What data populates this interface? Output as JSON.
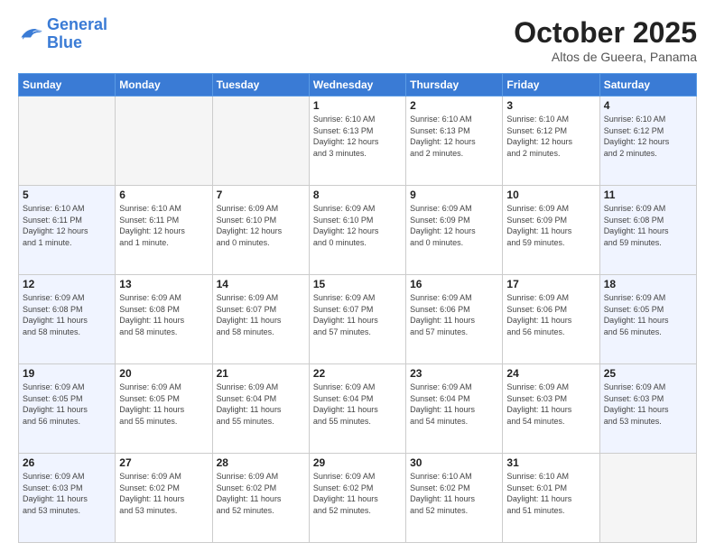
{
  "header": {
    "logo_line1": "General",
    "logo_line2": "Blue",
    "month": "October 2025",
    "location": "Altos de Gueera, Panama"
  },
  "weekdays": [
    "Sunday",
    "Monday",
    "Tuesday",
    "Wednesday",
    "Thursday",
    "Friday",
    "Saturday"
  ],
  "weeks": [
    [
      {
        "day": "",
        "info": ""
      },
      {
        "day": "",
        "info": ""
      },
      {
        "day": "",
        "info": ""
      },
      {
        "day": "1",
        "info": "Sunrise: 6:10 AM\nSunset: 6:13 PM\nDaylight: 12 hours\nand 3 minutes."
      },
      {
        "day": "2",
        "info": "Sunrise: 6:10 AM\nSunset: 6:13 PM\nDaylight: 12 hours\nand 2 minutes."
      },
      {
        "day": "3",
        "info": "Sunrise: 6:10 AM\nSunset: 6:12 PM\nDaylight: 12 hours\nand 2 minutes."
      },
      {
        "day": "4",
        "info": "Sunrise: 6:10 AM\nSunset: 6:12 PM\nDaylight: 12 hours\nand 2 minutes."
      }
    ],
    [
      {
        "day": "5",
        "info": "Sunrise: 6:10 AM\nSunset: 6:11 PM\nDaylight: 12 hours\nand 1 minute."
      },
      {
        "day": "6",
        "info": "Sunrise: 6:10 AM\nSunset: 6:11 PM\nDaylight: 12 hours\nand 1 minute."
      },
      {
        "day": "7",
        "info": "Sunrise: 6:09 AM\nSunset: 6:10 PM\nDaylight: 12 hours\nand 0 minutes."
      },
      {
        "day": "8",
        "info": "Sunrise: 6:09 AM\nSunset: 6:10 PM\nDaylight: 12 hours\nand 0 minutes."
      },
      {
        "day": "9",
        "info": "Sunrise: 6:09 AM\nSunset: 6:09 PM\nDaylight: 12 hours\nand 0 minutes."
      },
      {
        "day": "10",
        "info": "Sunrise: 6:09 AM\nSunset: 6:09 PM\nDaylight: 11 hours\nand 59 minutes."
      },
      {
        "day": "11",
        "info": "Sunrise: 6:09 AM\nSunset: 6:08 PM\nDaylight: 11 hours\nand 59 minutes."
      }
    ],
    [
      {
        "day": "12",
        "info": "Sunrise: 6:09 AM\nSunset: 6:08 PM\nDaylight: 11 hours\nand 58 minutes."
      },
      {
        "day": "13",
        "info": "Sunrise: 6:09 AM\nSunset: 6:08 PM\nDaylight: 11 hours\nand 58 minutes."
      },
      {
        "day": "14",
        "info": "Sunrise: 6:09 AM\nSunset: 6:07 PM\nDaylight: 11 hours\nand 58 minutes."
      },
      {
        "day": "15",
        "info": "Sunrise: 6:09 AM\nSunset: 6:07 PM\nDaylight: 11 hours\nand 57 minutes."
      },
      {
        "day": "16",
        "info": "Sunrise: 6:09 AM\nSunset: 6:06 PM\nDaylight: 11 hours\nand 57 minutes."
      },
      {
        "day": "17",
        "info": "Sunrise: 6:09 AM\nSunset: 6:06 PM\nDaylight: 11 hours\nand 56 minutes."
      },
      {
        "day": "18",
        "info": "Sunrise: 6:09 AM\nSunset: 6:05 PM\nDaylight: 11 hours\nand 56 minutes."
      }
    ],
    [
      {
        "day": "19",
        "info": "Sunrise: 6:09 AM\nSunset: 6:05 PM\nDaylight: 11 hours\nand 56 minutes."
      },
      {
        "day": "20",
        "info": "Sunrise: 6:09 AM\nSunset: 6:05 PM\nDaylight: 11 hours\nand 55 minutes."
      },
      {
        "day": "21",
        "info": "Sunrise: 6:09 AM\nSunset: 6:04 PM\nDaylight: 11 hours\nand 55 minutes."
      },
      {
        "day": "22",
        "info": "Sunrise: 6:09 AM\nSunset: 6:04 PM\nDaylight: 11 hours\nand 55 minutes."
      },
      {
        "day": "23",
        "info": "Sunrise: 6:09 AM\nSunset: 6:04 PM\nDaylight: 11 hours\nand 54 minutes."
      },
      {
        "day": "24",
        "info": "Sunrise: 6:09 AM\nSunset: 6:03 PM\nDaylight: 11 hours\nand 54 minutes."
      },
      {
        "day": "25",
        "info": "Sunrise: 6:09 AM\nSunset: 6:03 PM\nDaylight: 11 hours\nand 53 minutes."
      }
    ],
    [
      {
        "day": "26",
        "info": "Sunrise: 6:09 AM\nSunset: 6:03 PM\nDaylight: 11 hours\nand 53 minutes."
      },
      {
        "day": "27",
        "info": "Sunrise: 6:09 AM\nSunset: 6:02 PM\nDaylight: 11 hours\nand 53 minutes."
      },
      {
        "day": "28",
        "info": "Sunrise: 6:09 AM\nSunset: 6:02 PM\nDaylight: 11 hours\nand 52 minutes."
      },
      {
        "day": "29",
        "info": "Sunrise: 6:09 AM\nSunset: 6:02 PM\nDaylight: 11 hours\nand 52 minutes."
      },
      {
        "day": "30",
        "info": "Sunrise: 6:10 AM\nSunset: 6:02 PM\nDaylight: 11 hours\nand 52 minutes."
      },
      {
        "day": "31",
        "info": "Sunrise: 6:10 AM\nSunset: 6:01 PM\nDaylight: 11 hours\nand 51 minutes."
      },
      {
        "day": "",
        "info": ""
      }
    ]
  ]
}
